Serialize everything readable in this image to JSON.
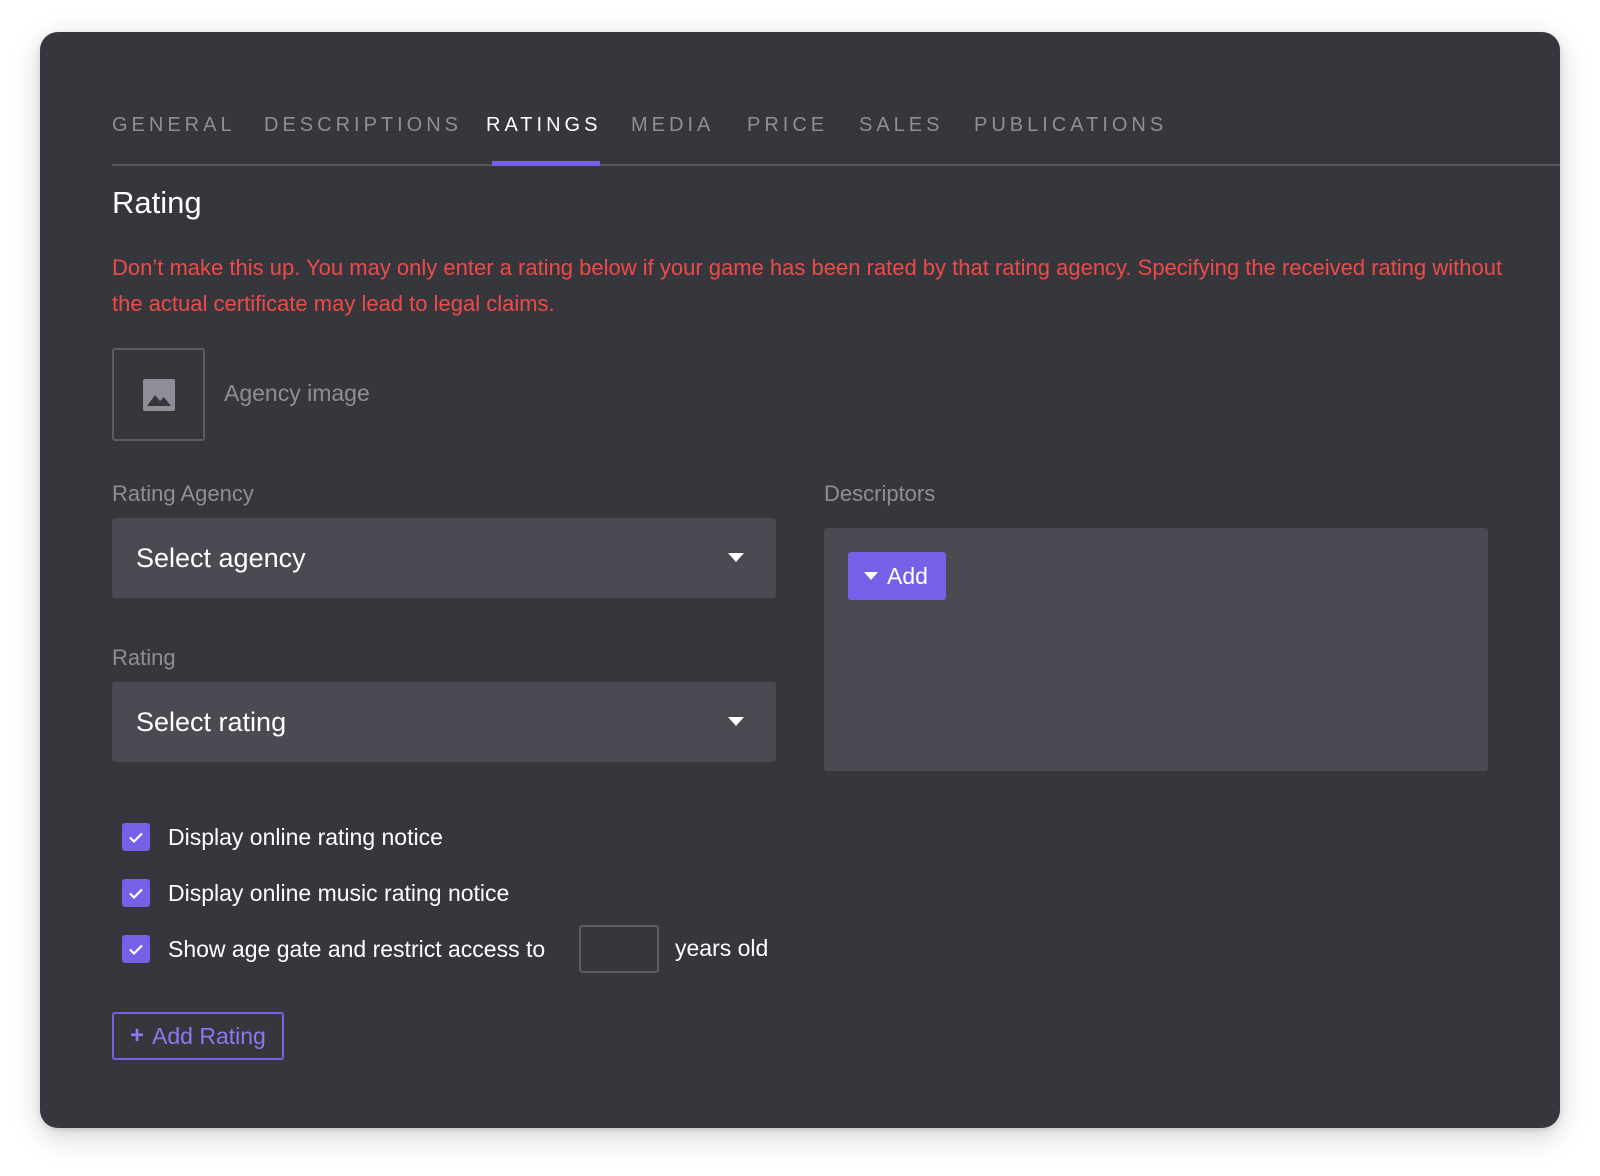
{
  "tabs": [
    {
      "label": "GENERAL",
      "active": false
    },
    {
      "label": "DESCRIPTIONS",
      "active": false
    },
    {
      "label": "RATINGS",
      "active": true
    },
    {
      "label": "MEDIA",
      "active": false
    },
    {
      "label": "PRICE",
      "active": false
    },
    {
      "label": "SALES",
      "active": false
    },
    {
      "label": "PUBLICATIONS",
      "active": false
    }
  ],
  "section": {
    "title": "Rating",
    "warning": "Don’t make this up. You may only enter a rating below if your game has been rated by that rating agency. Specifying the received rating without the actual certificate may lead to legal claims."
  },
  "agency_image": {
    "label": "Agency image",
    "icon": "image-placeholder-icon"
  },
  "rating_agency": {
    "label": "Rating Agency",
    "value": "Select agency"
  },
  "rating": {
    "label": "Rating",
    "value": "Select rating"
  },
  "descriptors": {
    "label": "Descriptors",
    "add_label": "Add"
  },
  "checkboxes": {
    "online_rating_notice": {
      "label": "Display online rating notice",
      "checked": true
    },
    "online_music_notice": {
      "label": "Display online music rating notice",
      "checked": true
    },
    "age_gate": {
      "label": "Show age gate and restrict access to",
      "checked": true,
      "value": "",
      "suffix": "years old"
    }
  },
  "add_rating": {
    "label": "Add Rating"
  },
  "colors": {
    "background": "#36373c",
    "field": "#4a4b52",
    "accent": "#7561e8",
    "warning": "#ee4a4a",
    "muted": "#8e8f96"
  }
}
